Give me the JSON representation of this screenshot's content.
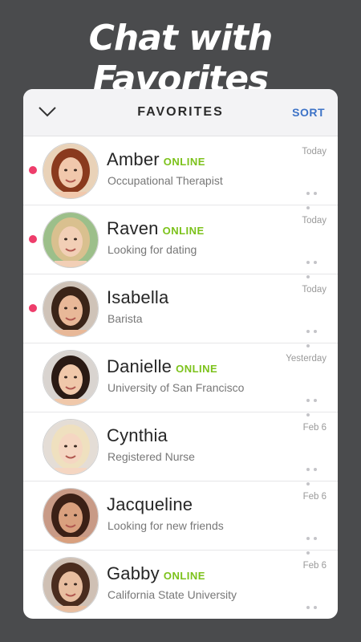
{
  "hero_title": "Chat with Favorites",
  "header": {
    "title": "FAVORITES",
    "sort_label": "SORT"
  },
  "online_label": "ONLINE",
  "colors": {
    "background": "#4a4b4d",
    "accent": "#3d73c7",
    "online": "#7cc21b",
    "unread_dot": "#ee3d6b"
  },
  "contacts": [
    {
      "name": "Amber",
      "subtitle": "Occupational Therapist",
      "time": "Today",
      "online": true,
      "unread": true
    },
    {
      "name": "Raven",
      "subtitle": "Looking for dating",
      "time": "Today",
      "online": true,
      "unread": true
    },
    {
      "name": "Isabella",
      "subtitle": "Barista",
      "time": "Today",
      "online": false,
      "unread": true
    },
    {
      "name": "Danielle",
      "subtitle": "University of San Francisco",
      "time": "Yesterday",
      "online": true,
      "unread": false
    },
    {
      "name": "Cynthia",
      "subtitle": "Registered Nurse",
      "time": "Feb 6",
      "online": false,
      "unread": false
    },
    {
      "name": "Jacqueline",
      "subtitle": "Looking for new friends",
      "time": "Feb 6",
      "online": false,
      "unread": false
    },
    {
      "name": "Gabby",
      "subtitle": "California State University",
      "time": "Feb 6",
      "online": true,
      "unread": false
    }
  ]
}
